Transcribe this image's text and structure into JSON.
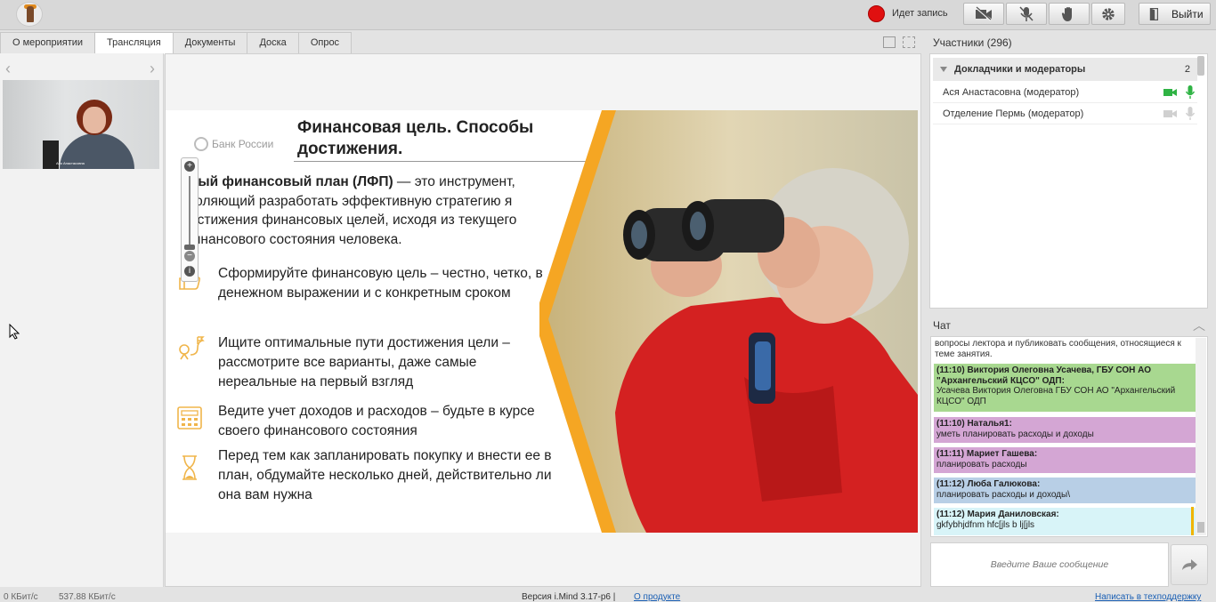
{
  "topbar": {
    "recording_text": "Идет запись",
    "exit_label": "Выйти",
    "icons": [
      "video-off-icon",
      "mic-off-icon",
      "raise-hand-icon",
      "gear-icon",
      "door-exit-icon"
    ]
  },
  "tabs": [
    {
      "label": "О мероприятии"
    },
    {
      "label": "Трансляция",
      "active": true
    },
    {
      "label": "Документы"
    },
    {
      "label": "Доска"
    },
    {
      "label": "Опрос"
    }
  ],
  "video": {
    "caption": "Ася Анастасовна"
  },
  "slide": {
    "logo_text": "Банк России",
    "title": "Финансовая цель. Способы достижения.",
    "intro_bold": "чный финансовый план (ЛФП)",
    "intro_rest": " — это инструмент, зволяющий разработать эффективную стратегию я достижения финансовых целей, исходя из текущего финансового состояния человека.",
    "bullets": [
      {
        "icon": "thumbs-up-icon",
        "text": "Сформируйте финансовую цель – честно, четко, в денежном выражении и с конкретным сроком"
      },
      {
        "icon": "route-pin-icon",
        "text": "Ищите оптимальные пути достижения цели – рассмотрите все варианты, даже самые нереальные на первый взгляд"
      },
      {
        "icon": "calculator-icon",
        "text": "Ведите учет доходов и расходов – будьте в курсе своего финансового состояния"
      },
      {
        "icon": "hourglass-icon",
        "text": "Перед тем как запланировать покупку и внести ее в план, обдумайте несколько дней, действительно ли она вам нужна"
      }
    ],
    "accent_color": "#f5a623"
  },
  "participants": {
    "label": "Участники (296)",
    "group_title": "Докладчики и модераторы",
    "group_count": "2",
    "rows": [
      {
        "name": "Ася Анастасовна (модератор)",
        "active": true
      },
      {
        "name": "Отделение Пермь (модератор)",
        "active": false
      }
    ]
  },
  "chat": {
    "label": "Чат",
    "system_text": "вопросы лектора и публиковать сообщения, относящиеся к теме занятия.",
    "messages": [
      {
        "header": "(11:10) Виктория Олеговна Усачева, ГБУ СОН АО \"Архангельский КЦСО\" ОДП:",
        "body": "Усачева Виктория Олеговна ГБУ СОН АО \"Архангельский КЦСО\" ОДП",
        "color": "#a8d890"
      },
      {
        "header": "(11:10) Наталья1:",
        "body": "уметь планировать расходы и доходы",
        "color": "#d4a6d4"
      },
      {
        "header": "(11:11) Мариет Гашева:",
        "body": "планировать расходы",
        "color": "#d4a6d4"
      },
      {
        "header": "(11:12) Люба Галюкова:",
        "body": "планировать расходы и доходы\\",
        "color": "#b8cfe6"
      },
      {
        "header": "(11:12) Мария Даниловская:",
        "body": "gkfybhjdfnm hfc[jls b lj[jls",
        "color": "#d8f4f8"
      }
    ],
    "input_placeholder": "Введите Ваше сообщение"
  },
  "footer": {
    "upload": "0 КБит/с",
    "download": "537.88 КБит/с",
    "version": "Версия i.Mind 3.17-p6  |",
    "about_link": "О продукте",
    "support_link": "Написать в техподдержку"
  }
}
